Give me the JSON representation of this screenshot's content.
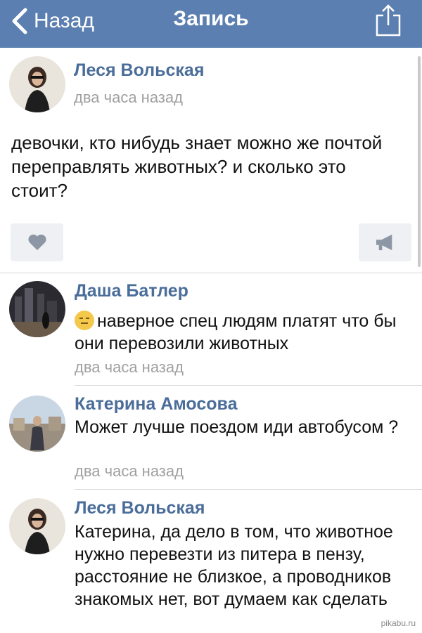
{
  "nav": {
    "back_label": "Назад",
    "title": "Запись"
  },
  "post": {
    "author": "Леся Вольская",
    "time": "два часа назад",
    "text": "девочки, кто нибудь знает можно же почтой переправлять животных? и сколько это стоит?"
  },
  "comments": [
    {
      "author": "Даша Батлер",
      "text": "наверное спец людям платят что бы они перевозили животных",
      "time": "два часа назад"
    },
    {
      "author": "Катерина Амосова",
      "text": "Может лучше поездом иди автобусом ?",
      "time": "два часа назад"
    },
    {
      "author": "Леся Вольская",
      "text": "Катерина, да дело в том, что животное нужно перевезти из питера в пензу, расстояние не близкое, а проводников знакомых нет, вот думаем как сделать"
    }
  ],
  "watermark": "pikabu.ru",
  "colors": {
    "navbar": "#5b7fb0",
    "author_link": "#4a6d9a",
    "muted": "#a0a0a0"
  }
}
